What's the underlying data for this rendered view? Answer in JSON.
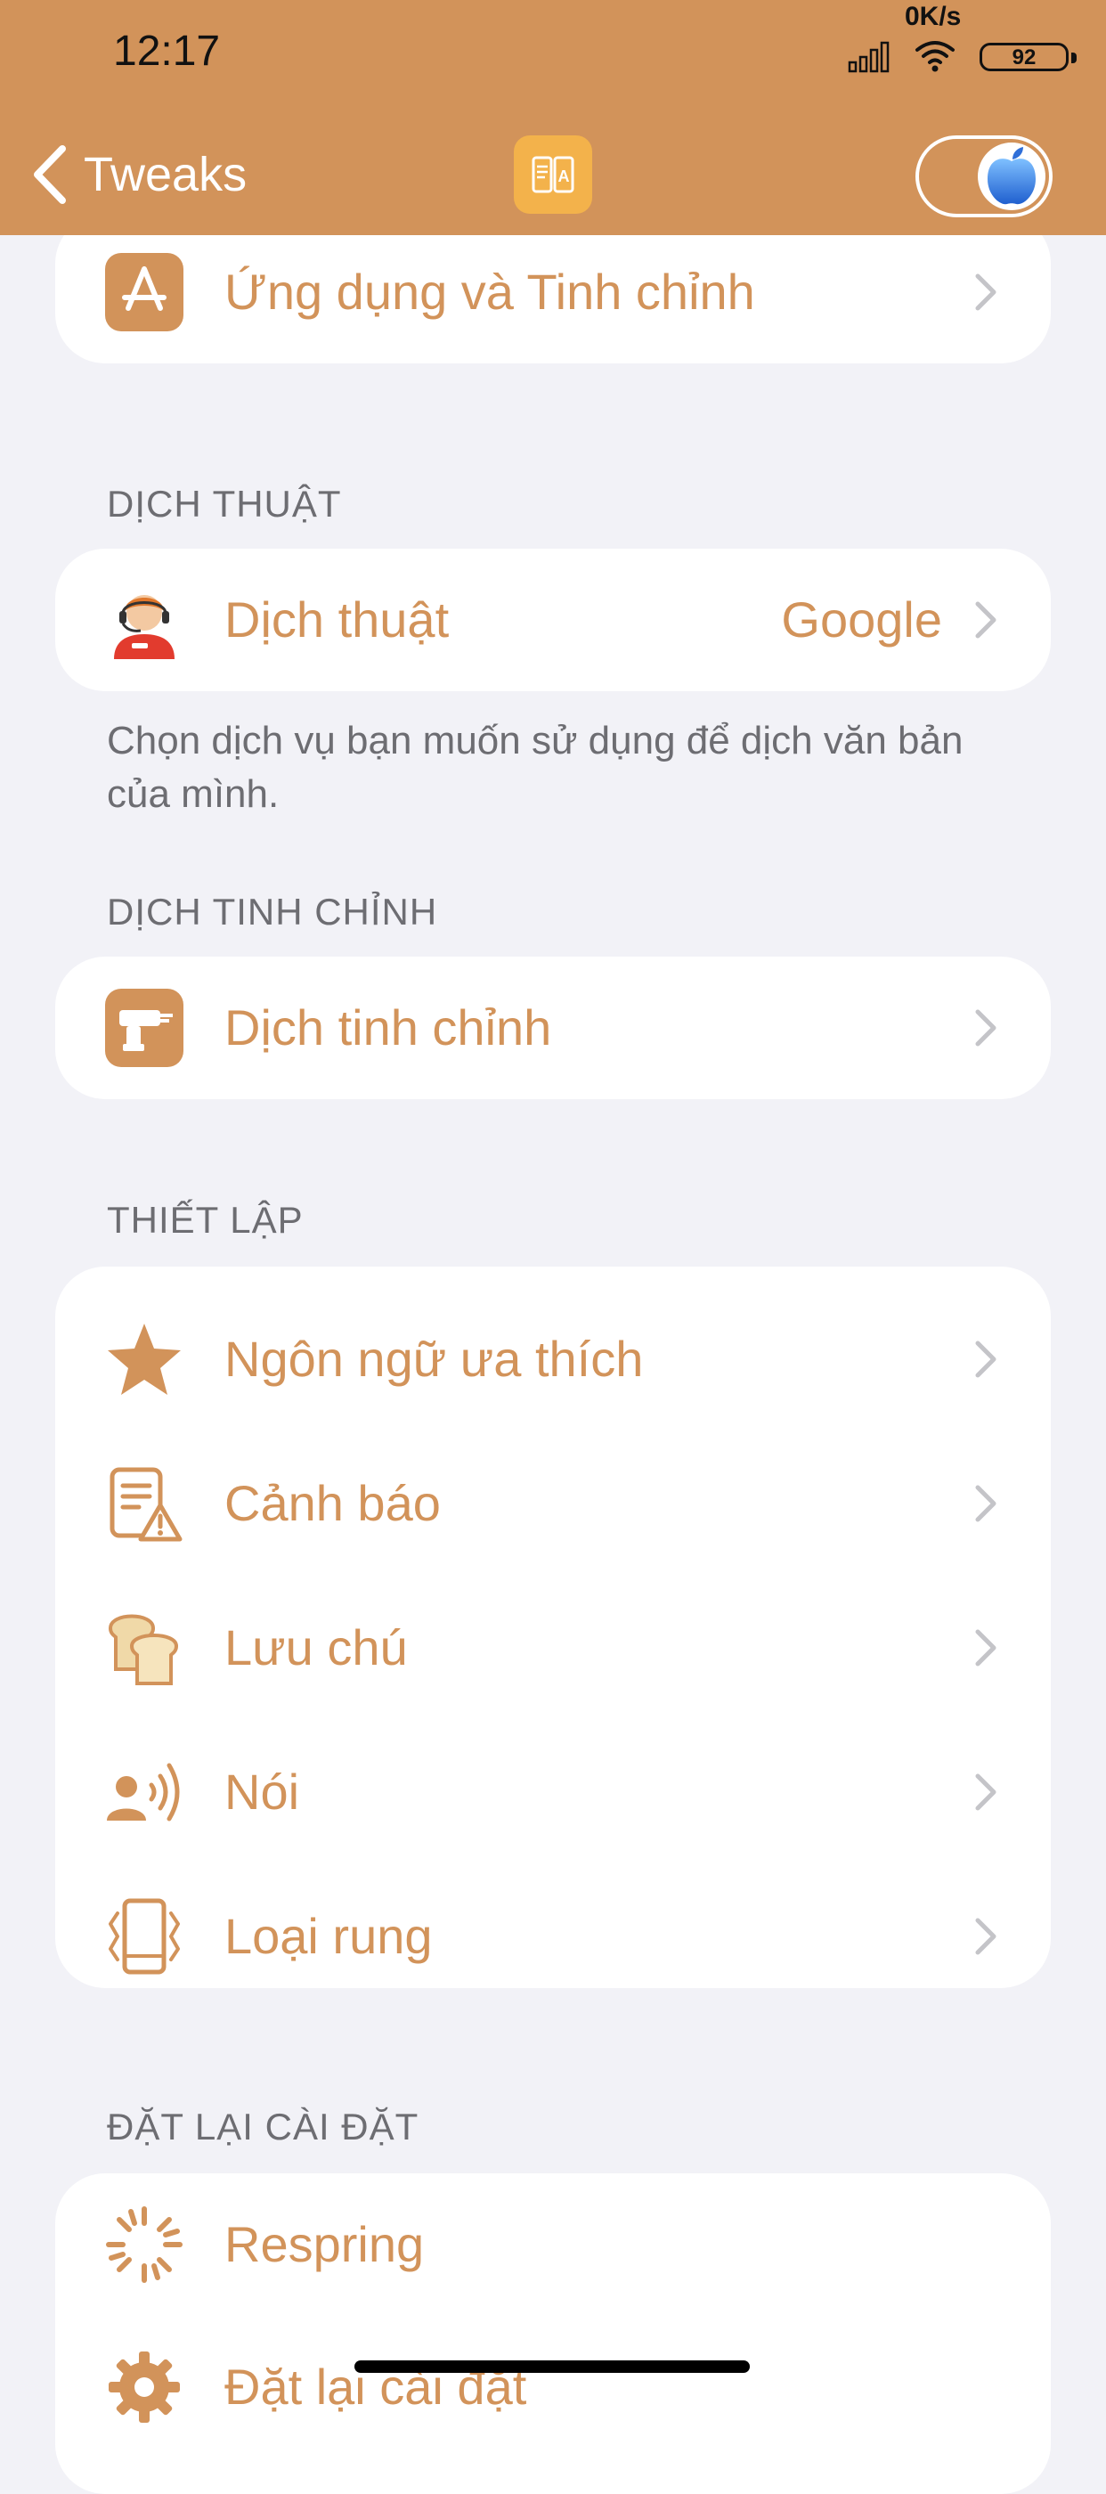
{
  "status_bar": {
    "time": "12:17",
    "net_speed": "0K/s",
    "battery": "92"
  },
  "nav": {
    "back_label": "Tweaks",
    "center_icon": "translate-app-icon",
    "toggle_state": "on"
  },
  "sections": {
    "top": {
      "item_label": "Ứng dụng và Tinh chỉnh"
    },
    "translation": {
      "header": "DỊCH THUẬT",
      "item_label": "Dịch thuật",
      "item_value": "Google",
      "footer": "Chọn dịch vụ bạn muốn sử dụng để dịch văn bản của mình."
    },
    "translate_tweaks": {
      "header": "DỊCH TINH CHỈNH",
      "item_label": "Dịch tinh chỉnh"
    },
    "settings": {
      "header": "THIẾT LẬP",
      "items": [
        {
          "label": "Ngôn ngữ ưa thích",
          "icon": "star-icon"
        },
        {
          "label": "Cảnh báo",
          "icon": "warning-document-icon"
        },
        {
          "label": "Lưu chú",
          "icon": "bread-icon"
        },
        {
          "label": "Nói",
          "icon": "speaking-person-icon"
        },
        {
          "label": "Loại rung",
          "icon": "vibration-phone-icon"
        }
      ]
    },
    "reset": {
      "header": "ĐẶT LẠI CÀI ĐẶT",
      "items": [
        {
          "label": "Respring",
          "icon": "loading-spinner-icon"
        },
        {
          "label": "Đặt lại cài đặt",
          "icon": "gear-icon"
        }
      ]
    }
  },
  "colors": {
    "accent": "#d2935a",
    "background": "#f2f2f7",
    "secondary_text": "#6d6d72"
  }
}
